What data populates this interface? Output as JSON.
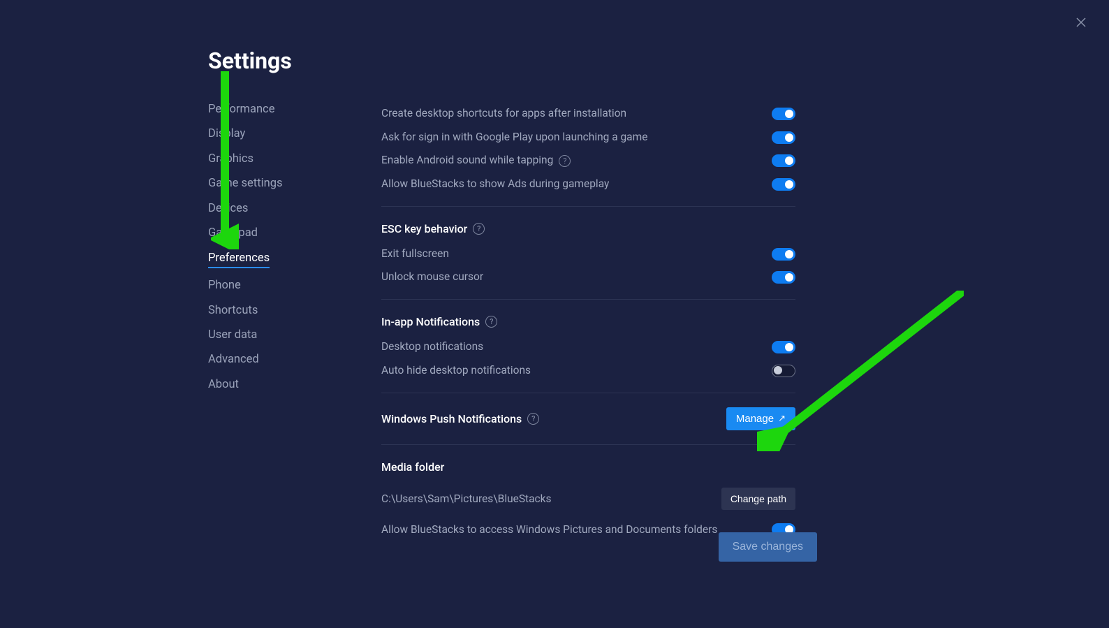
{
  "title": "Settings",
  "sidebar": {
    "items": [
      {
        "label": "Performance",
        "active": false
      },
      {
        "label": "Display",
        "active": false
      },
      {
        "label": "Graphics",
        "active": false
      },
      {
        "label": "Game settings",
        "active": false
      },
      {
        "label": "Devices",
        "active": false
      },
      {
        "label": "Gamepad",
        "active": false
      },
      {
        "label": "Preferences",
        "active": true
      },
      {
        "label": "Phone",
        "active": false
      },
      {
        "label": "Shortcuts",
        "active": false
      },
      {
        "label": "User data",
        "active": false
      },
      {
        "label": "Advanced",
        "active": false
      },
      {
        "label": "About",
        "active": false
      }
    ]
  },
  "settings": {
    "top": [
      {
        "label": "Create desktop shortcuts for apps after installation",
        "on": true,
        "help": false
      },
      {
        "label": "Ask for sign in with Google Play upon launching a game",
        "on": true,
        "help": false
      },
      {
        "label": "Enable Android sound while tapping",
        "on": true,
        "help": true
      },
      {
        "label": "Allow BlueStacks to show Ads during gameplay",
        "on": true,
        "help": false
      }
    ],
    "esc": {
      "title": "ESC key behavior",
      "items": [
        {
          "label": "Exit fullscreen",
          "on": true
        },
        {
          "label": "Unlock mouse cursor",
          "on": true
        }
      ]
    },
    "inapp": {
      "title": "In-app Notifications",
      "items": [
        {
          "label": "Desktop notifications",
          "on": true
        },
        {
          "label": "Auto hide desktop notifications",
          "on": false
        }
      ]
    },
    "push": {
      "title": "Windows Push Notifications",
      "button": "Manage"
    },
    "media": {
      "title": "Media folder",
      "path": "C:\\Users\\Sam\\Pictures\\BlueStacks",
      "button": "Change path",
      "allow": {
        "label": "Allow BlueStacks to access Windows Pictures and Documents folders",
        "on": true
      }
    }
  },
  "save_button": "Save changes"
}
